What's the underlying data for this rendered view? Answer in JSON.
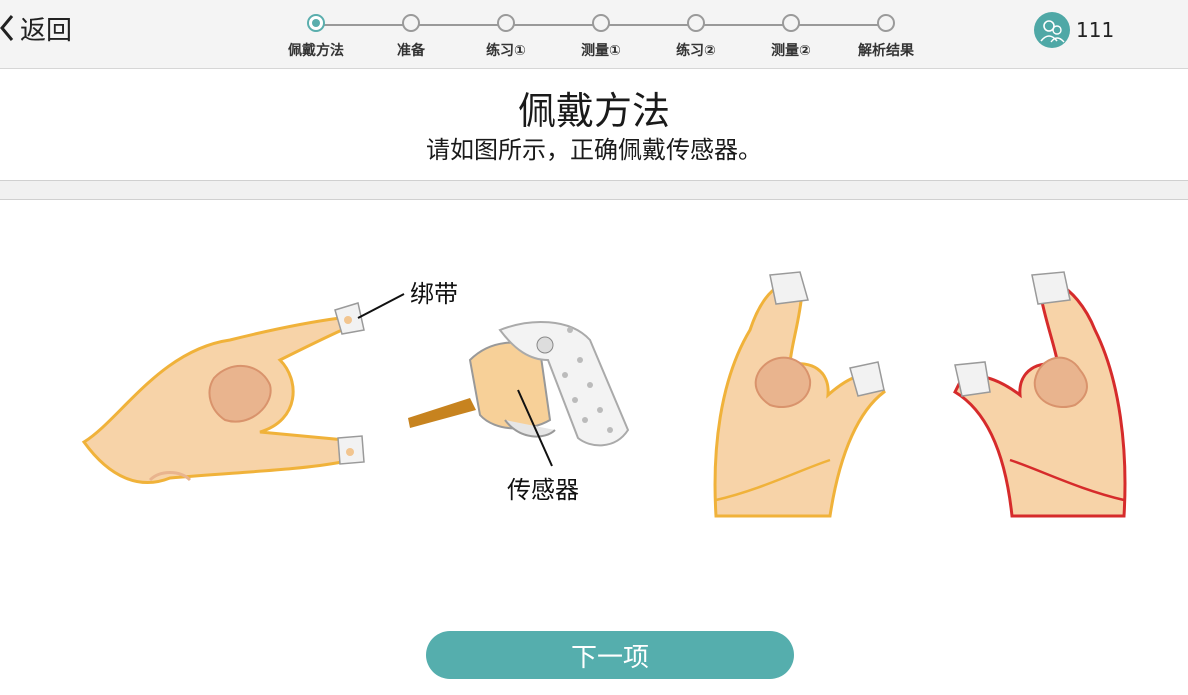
{
  "header": {
    "back_label": "返回",
    "user": {
      "name": "111",
      "icon": "user-avatar-icon"
    },
    "steps": [
      {
        "label": "佩戴方法",
        "active": true
      },
      {
        "label": "准备",
        "active": false
      },
      {
        "label": "练习①",
        "active": false
      },
      {
        "label": "测量①",
        "active": false
      },
      {
        "label": "练习②",
        "active": false
      },
      {
        "label": "测量②",
        "active": false
      },
      {
        "label": "解析结果",
        "active": false
      }
    ]
  },
  "main": {
    "title": "佩戴方法",
    "subtitle": "请如图所示，正确佩戴传感器。",
    "annotations": {
      "band": "绑带",
      "sensor": "传感器"
    }
  },
  "footer": {
    "next_label": "下一项"
  },
  "colors": {
    "accent": "#55aead",
    "skin": "#f7d3a8",
    "skin_shadow": "#e3a884",
    "left_outline": "#f0b23a",
    "right_outline": "#d62b2b",
    "cable": "#c7831f"
  }
}
